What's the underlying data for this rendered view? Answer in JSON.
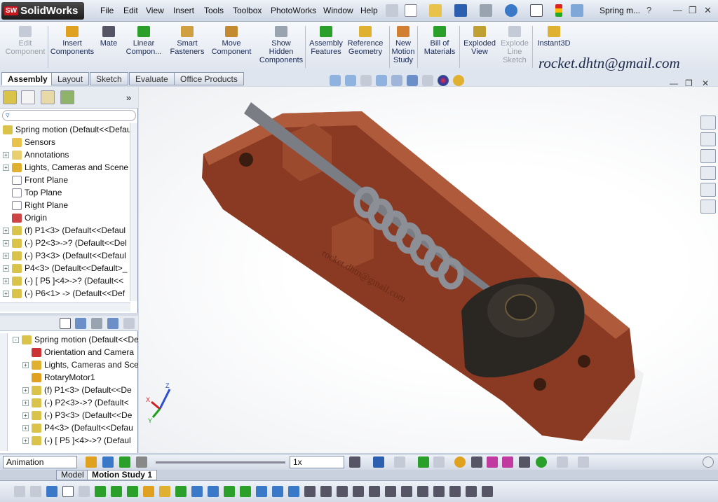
{
  "app": {
    "logo_badge": "SW",
    "logo_text": "SolidWorks"
  },
  "menu": [
    "File",
    "Edit",
    "View",
    "Insert",
    "Tools",
    "Toolbox",
    "PhotoWorks",
    "Window",
    "Help"
  ],
  "document_title": "Spring m...",
  "help_label": "?",
  "command_manager": [
    {
      "label": "Edit\nComponent",
      "disabled": true
    },
    {
      "label": "Insert\nComponents",
      "disabled": false
    },
    {
      "label": "Mate",
      "disabled": false
    },
    {
      "label": "Linear\nCompon...",
      "disabled": false
    },
    {
      "label": "Smart\nFasteners",
      "disabled": false
    },
    {
      "label": "Move\nComponent",
      "disabled": false
    },
    {
      "label": "Show\nHidden\nComponents",
      "disabled": false
    },
    {
      "label": "Assembly\nFeatures",
      "disabled": false
    },
    {
      "label": "Reference\nGeometry",
      "disabled": false
    },
    {
      "label": "New\nMotion\nStudy",
      "disabled": false
    },
    {
      "label": "Bill of\nMaterials",
      "disabled": false
    },
    {
      "label": "Exploded\nView",
      "disabled": false
    },
    {
      "label": "Explode\nLine\nSketch",
      "disabled": true
    },
    {
      "label": "Instant3D",
      "disabled": false
    }
  ],
  "watermark": "rocket.dhtn@gmail.com",
  "tabs": [
    "Assembly",
    "Layout",
    "Sketch",
    "Evaluate",
    "Office Products"
  ],
  "feature_tree": [
    "Spring motion  (Default<<Defaul",
    "Sensors",
    "Annotations",
    "Lights, Cameras and Scene",
    "Front Plane",
    "Top Plane",
    "Right Plane",
    "Origin",
    "(f) P1<3> (Default<<Defaul",
    "(-) P2<3>->? (Default<<Del",
    "(-) P3<3> (Default<<Defaul",
    "P4<3> (Default<<Default>_",
    "(-) [ P5 ]<4>->? (Default<<",
    "(-) P6<1> -> (Default<<Def"
  ],
  "motion_tree": [
    "Spring motion  (Default<<De",
    "Orientation and Camera",
    "Lights, Cameras and Sce",
    "RotaryMotor1",
    "(f) P1<3> (Default<<De",
    "(-) P2<3>->? (Default<",
    "(-) P3<3> (Default<<De",
    "P4<3> (Default<<Defau",
    "(-) [ P5 ]<4>->? (Defaul"
  ],
  "part_engraving": "rocket.dhtn@gmail.com",
  "triad": {
    "x": "X",
    "y": "Y",
    "z": "Z"
  },
  "motion_bar": {
    "study_type": "Animation",
    "playback_speed": "1x"
  },
  "bottom_tabs": [
    "Model",
    "Motion Study 1"
  ],
  "colors": {
    "part_body": "#8a3a22",
    "part_dark": "#2a2622",
    "spring": "#8c8f96",
    "brand_red": "#c8141b"
  }
}
